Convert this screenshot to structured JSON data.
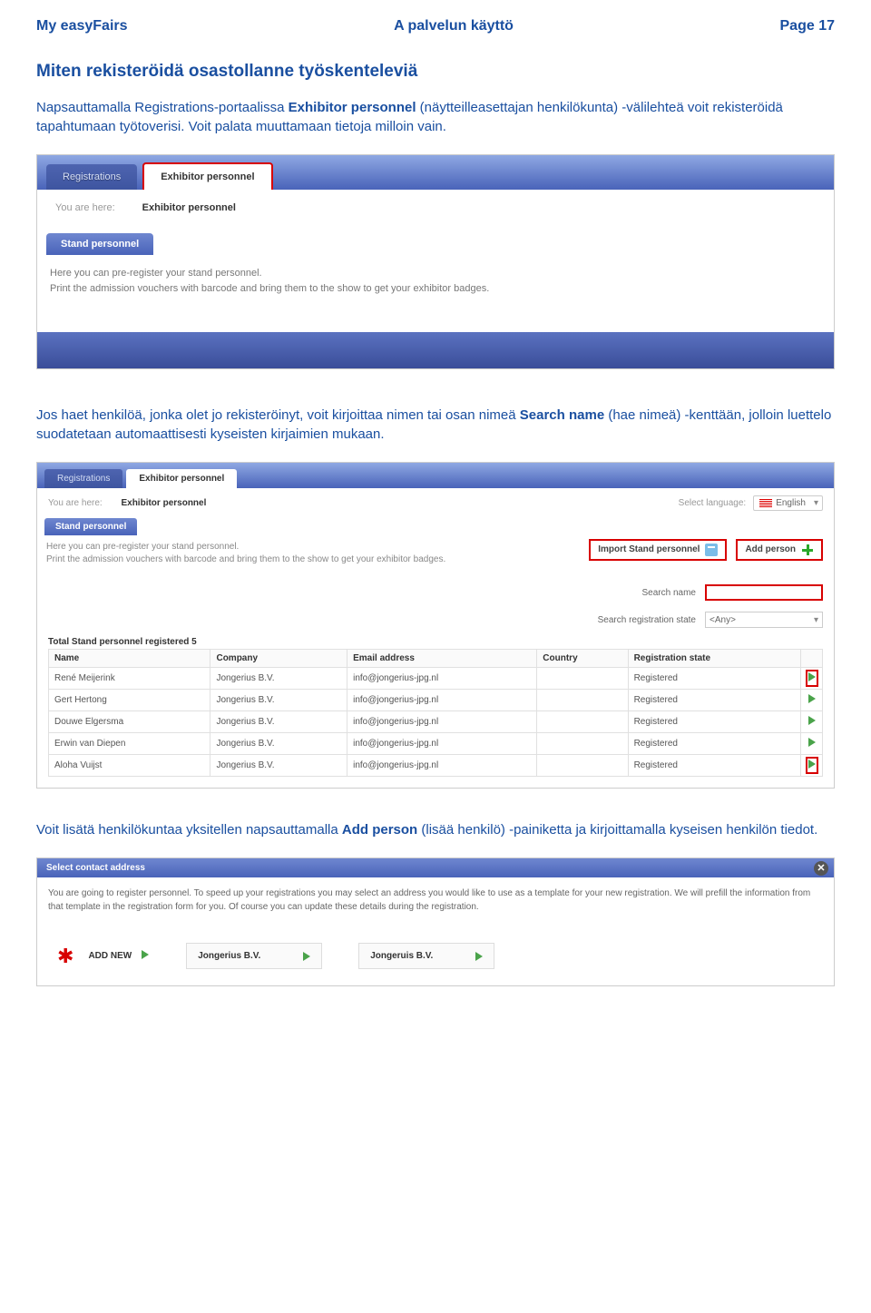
{
  "header": {
    "left": "My easyFairs",
    "center": "A palvelun käyttö",
    "right": "Page 17"
  },
  "title": "Miten rekisteröidä osastollanne työskenteleviä",
  "para1": {
    "pre": "Napsauttamalla Registrations-portaalissa ",
    "bold": "Exhibitor personnel",
    "post": " (näytteilleasettajan henkilökunta) -välilehteä voit rekisteröidä tapahtumaan työtoverisi. Voit palata muuttamaan tietoja milloin vain."
  },
  "shot1": {
    "tab_registrations": "Registrations",
    "tab_exhibitor": "Exhibitor personnel",
    "yah_label": "You are here:",
    "yah_value": "Exhibitor personnel",
    "subtab": "Stand personnel",
    "line1": "Here you can pre-register your stand personnel.",
    "line2": "Print the admission vouchers with barcode and bring them to the show to get your exhibitor badges."
  },
  "para2": {
    "pre": "Jos haet henkilöä, jonka olet jo rekisteröinyt, voit kirjoittaa nimen tai osan nimeä ",
    "bold1": "Search name",
    "post": " (hae nimeä) -kenttään, jolloin luettelo suodatetaan automaattisesti kyseisten kirjaimien mukaan."
  },
  "shot2": {
    "tab_registrations": "Registrations",
    "tab_exhibitor": "Exhibitor personnel",
    "yah_label": "You are here:",
    "yah_value": "Exhibitor personnel",
    "lang_label": "Select language:",
    "lang_value": "English",
    "subtab": "Stand personnel",
    "line1": "Here you can pre-register your stand personnel.",
    "line2": "Print the admission vouchers with barcode and bring them to the show to get your exhibitor badges.",
    "btn_import": "Import Stand personnel",
    "btn_add": "Add person",
    "search_name_label": "Search name",
    "search_state_label": "Search registration state",
    "search_state_value": "<Any>",
    "total_label": "Total Stand personnel registered 5",
    "cols": {
      "name": "Name",
      "company": "Company",
      "email": "Email address",
      "country": "Country",
      "state": "Registration state"
    },
    "rows": [
      {
        "name": "René Meijerink",
        "company": "Jongerius B.V.",
        "email": "info@jongerius-jpg.nl",
        "country": "",
        "state": "Registered",
        "hl": true
      },
      {
        "name": "Gert Hertong",
        "company": "Jongerius B.V.",
        "email": "info@jongerius-jpg.nl",
        "country": "",
        "state": "Registered",
        "hl": false
      },
      {
        "name": "Douwe Elgersma",
        "company": "Jongerius B.V.",
        "email": "info@jongerius-jpg.nl",
        "country": "",
        "state": "Registered",
        "hl": false
      },
      {
        "name": "Erwin van Diepen",
        "company": "Jongerius B.V.",
        "email": "info@jongerius-jpg.nl",
        "country": "",
        "state": "Registered",
        "hl": false
      },
      {
        "name": "Aloha Vuijst",
        "company": "Jongerius B.V.",
        "email": "info@jongerius-jpg.nl",
        "country": "",
        "state": "Registered",
        "hl": true
      }
    ]
  },
  "para3": {
    "pre": "Voit lisätä henkilökuntaa yksitellen napsauttamalla ",
    "bold": "Add person",
    "post": " (lisää henkilö) -painiketta ja kirjoittamalla kyseisen henkilön tiedot."
  },
  "shot3": {
    "title": "Select contact address",
    "body": "You are going to register personnel. To speed up your registrations you may select an address you would like to use as a template for your new registration. We will prefill the information from that template in the registration form for you. Of course you can update these details during the registration.",
    "addnew": "ADD NEW",
    "card1": "Jongerius B.V.",
    "card2": "Jongeruis B.V."
  }
}
